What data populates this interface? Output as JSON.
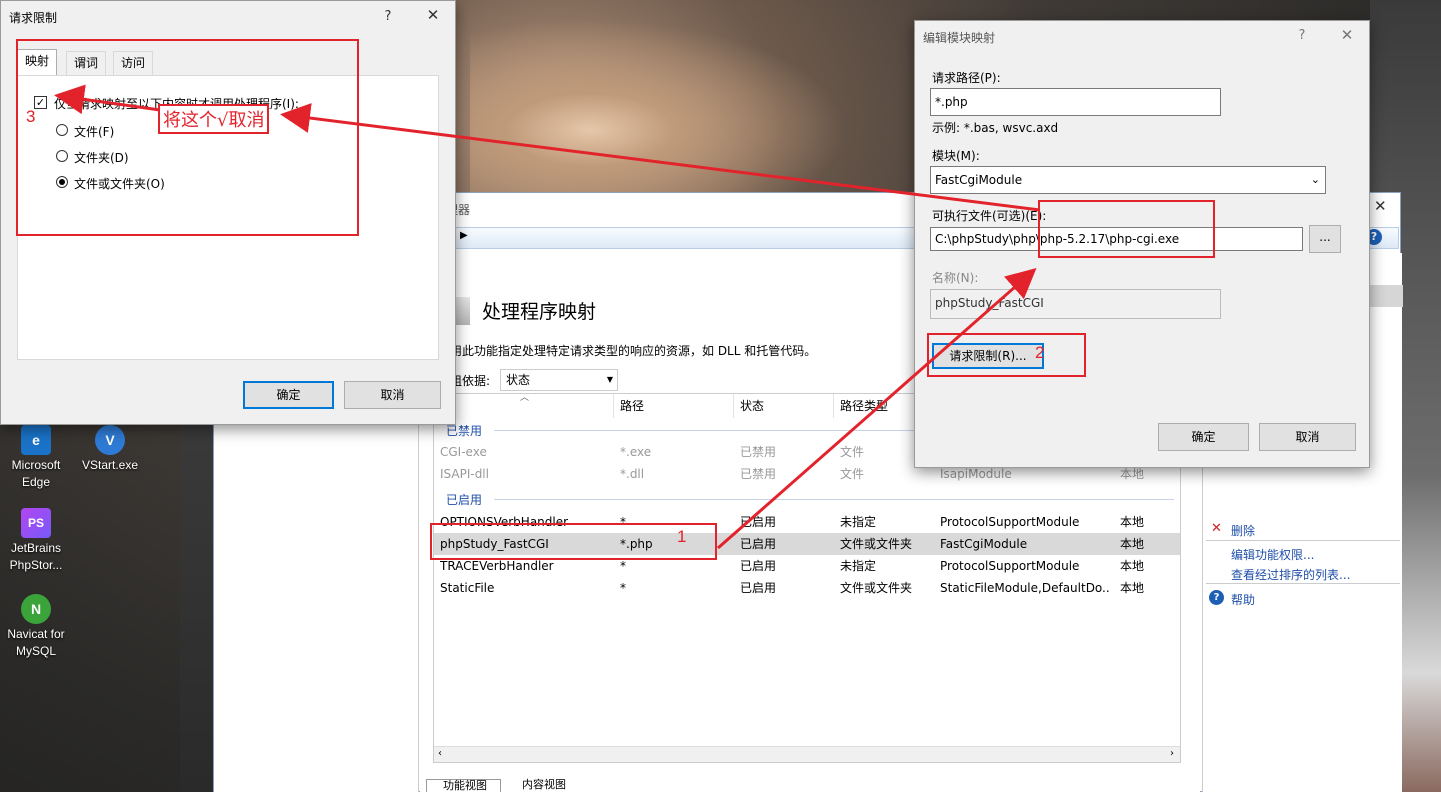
{
  "desktop": {
    "icons": [
      {
        "label": "Microsoft Edge",
        "glyph": "e"
      },
      {
        "label": "VStart.exe",
        "glyph": "V"
      },
      {
        "label": "JetBrains PhpStor...",
        "glyph": "PS"
      },
      {
        "label": "Navicat for MySQL",
        "glyph": "N"
      }
    ]
  },
  "iis": {
    "title_fragment": "理器",
    "feature_title": "处理程序映射",
    "description": "用此功能指定处理特定请求类型的响应的资源，如 DLL 和托管代码。",
    "group_by_label": "组依据:",
    "group_by_value": "状态",
    "columns": [
      "称",
      "路径",
      "状态",
      "路径类型"
    ],
    "groups": [
      {
        "label": "已禁用",
        "rows": [
          {
            "name": "CGI-exe",
            "path": "*.exe",
            "state": "已禁用",
            "path_type": "文件",
            "handler": "",
            "entry": ""
          },
          {
            "name": "ISAPI-dll",
            "path": "*.dll",
            "state": "已禁用",
            "path_type": "文件",
            "handler": "IsapiModule",
            "entry": "本地"
          }
        ]
      },
      {
        "label": "已启用",
        "rows": [
          {
            "name": "OPTIONSVerbHandler",
            "path": "*",
            "state": "已启用",
            "path_type": "未指定",
            "handler": "ProtocolSupportModule",
            "entry": "本地"
          },
          {
            "name": "phpStudy_FastCGI",
            "path": "*.php",
            "state": "已启用",
            "path_type": "文件或文件夹",
            "handler": "FastCgiModule",
            "entry": "本地"
          },
          {
            "name": "TRACEVerbHandler",
            "path": "*",
            "state": "已启用",
            "path_type": "未指定",
            "handler": "ProtocolSupportModule",
            "entry": "本地"
          },
          {
            "name": "StaticFile",
            "path": "*",
            "state": "已启用",
            "path_type": "文件或文件夹",
            "handler": "StaticFileModule,DefaultDo...",
            "entry": "本地"
          }
        ]
      }
    ],
    "bottom_tabs": [
      "功能视图",
      "内容视图"
    ],
    "actions": {
      "delete": "删除",
      "edit_permissions": "编辑功能权限...",
      "view_ordered": "查看经过排序的列表...",
      "help": "帮助"
    }
  },
  "restrictions_dialog": {
    "title": "请求限制",
    "help_glyph": "?",
    "close_glyph": "✕",
    "tabs": [
      "映射",
      "谓词",
      "访问"
    ],
    "checkbox_label": "仅当请求映射至以下内容时才调用处理程序(I):",
    "checkbox_checked": true,
    "radios": [
      {
        "label": "文件(F)",
        "selected": false
      },
      {
        "label": "文件夹(D)",
        "selected": false
      },
      {
        "label": "文件或文件夹(O)",
        "selected": true
      }
    ],
    "ok_label": "确定",
    "cancel_label": "取消"
  },
  "edit_module_dialog": {
    "title": "编辑模块映射",
    "help_glyph": "?",
    "close_glyph": "✕",
    "request_path_label": "请求路径(P):",
    "request_path_value": "*.php",
    "example": "示例: *.bas, wsvc.axd",
    "module_label": "模块(M):",
    "module_value": "FastCgiModule",
    "executable_label": "可执行文件(可选)(E):",
    "executable_value": "C:\\phpStudy\\php\\php-5.2.17\\php-cgi.exe",
    "browse_label": "...",
    "name_label": "名称(N):",
    "name_value": "phpStudy_FastCGI",
    "restrictions_button": "请求限制(R)...",
    "ok_label": "确定",
    "cancel_label": "取消"
  },
  "annotations": {
    "step1": "1",
    "step2": "2",
    "step3": "3",
    "callout": "将这个√取消",
    "color": "#e3232c"
  }
}
